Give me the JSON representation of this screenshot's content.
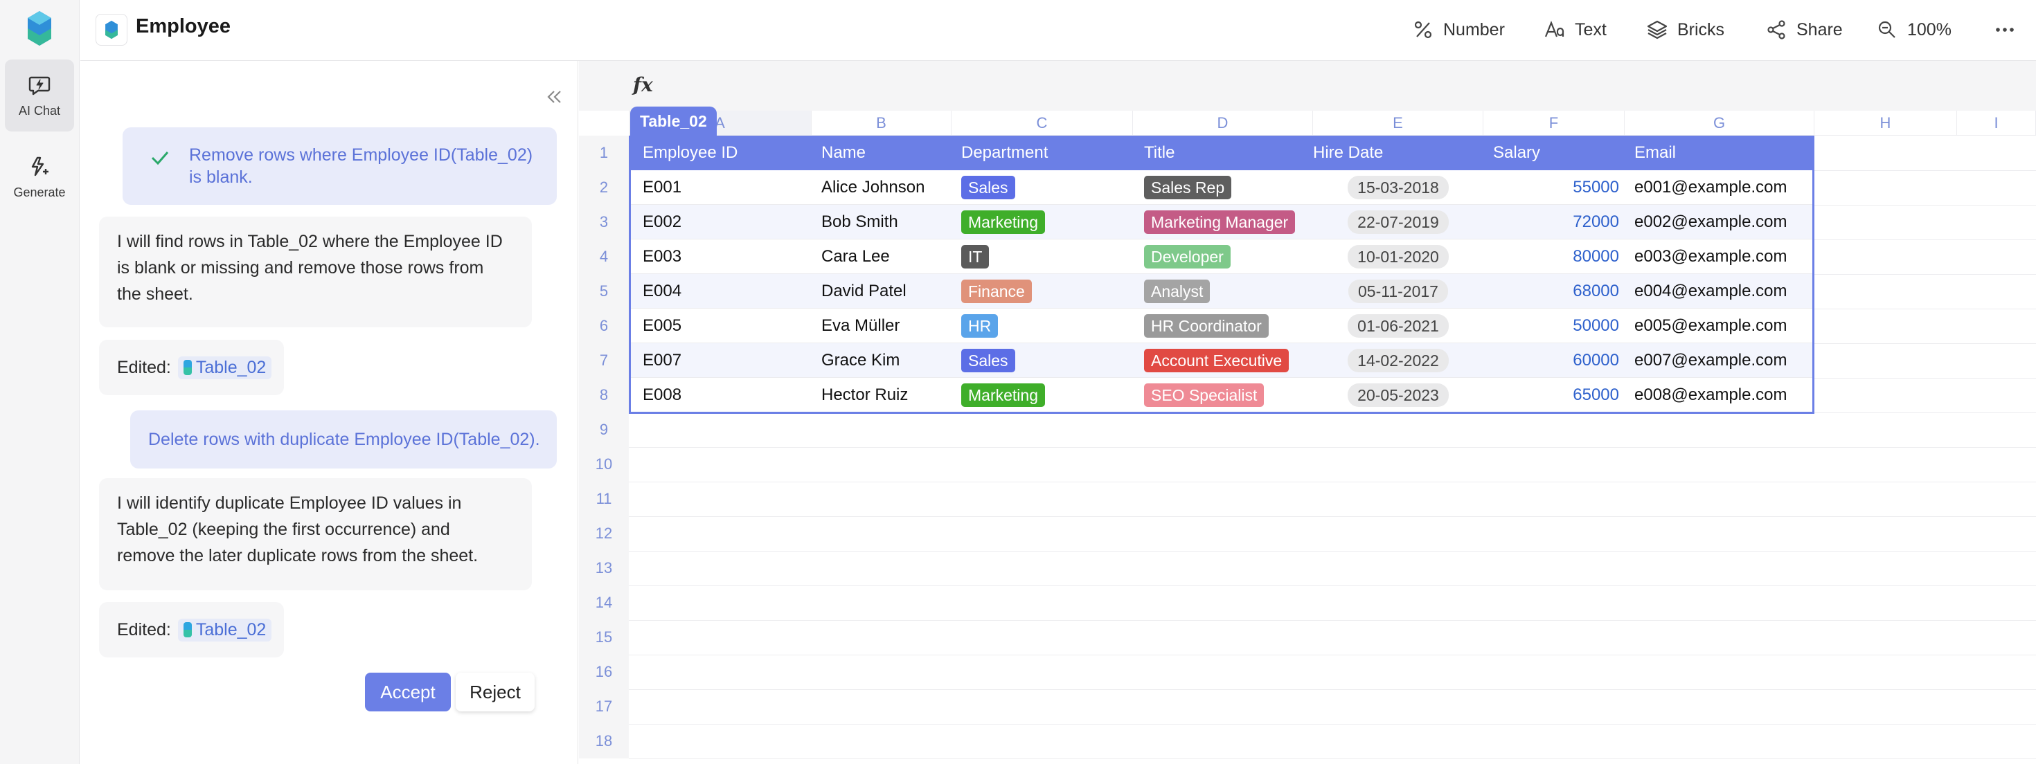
{
  "app": {
    "title": "Employee"
  },
  "rail": {
    "items": [
      {
        "label": "AI Chat"
      },
      {
        "label": "Generate"
      }
    ]
  },
  "toolbar": {
    "number": "Number",
    "text": "Text",
    "bricks": "Bricks",
    "share": "Share",
    "zoom": "100%"
  },
  "chat": {
    "messages": [
      {
        "role": "user",
        "text": "Remove rows where Employee ID(Table_02) is blank.",
        "checked": true
      },
      {
        "role": "ai",
        "text": "I will find rows in Table_02 where the Employee ID is blank or missing and remove those rows from the sheet."
      },
      {
        "role": "edited",
        "label": "Edited:",
        "ref": "Table_02"
      },
      {
        "role": "user",
        "text": "Delete rows with duplicate Employee ID(Table_02)."
      },
      {
        "role": "ai",
        "text": "I will identify duplicate Employee ID values in Table_02 (keeping the first occurrence) and remove the later duplicate rows from the sheet."
      },
      {
        "role": "edited",
        "label": "Edited:",
        "ref": "Table_02"
      }
    ],
    "accept_label": "Accept",
    "reject_label": "Reject"
  },
  "sheet": {
    "fx_label": "fx",
    "table_name": "Table_02",
    "columns": [
      "A",
      "B",
      "C",
      "D",
      "E",
      "F",
      "G",
      "H",
      "I"
    ],
    "row_numbers": [
      "1",
      "2",
      "3",
      "4",
      "5",
      "6",
      "7",
      "8",
      "9",
      "10",
      "11",
      "12",
      "13",
      "14",
      "15",
      "16",
      "17",
      "18"
    ],
    "headers": [
      "Employee ID",
      "Name",
      "Department",
      "Title",
      "Hire Date",
      "Salary",
      "Email"
    ],
    "rows": [
      {
        "id": "E001",
        "name": "Alice Johnson",
        "dept": "Sales",
        "dept_color": "#5c6ee6",
        "title": "Sales Rep",
        "title_color": "#5e5e5e",
        "hire": "15-03-2018",
        "salary": "55000",
        "email": "e001@example.com"
      },
      {
        "id": "E002",
        "name": "Bob Smith",
        "dept": "Marketing",
        "dept_color": "#3fae2a",
        "title": "Marketing Manager",
        "title_color": "#c45b86",
        "hire": "22-07-2019",
        "salary": "72000",
        "email": "e002@example.com"
      },
      {
        "id": "E003",
        "name": "Cara Lee",
        "dept": "IT",
        "dept_color": "#5a5a5a",
        "title": "Developer",
        "title_color": "#7ec98a",
        "hire": "10-01-2020",
        "salary": "80000",
        "email": "e003@example.com"
      },
      {
        "id": "E004",
        "name": "David Patel",
        "dept": "Finance",
        "dept_color": "#e0927a",
        "title": "Analyst",
        "title_color": "#a4a4a4",
        "hire": "05-11-2017",
        "salary": "68000",
        "email": "e004@example.com"
      },
      {
        "id": "E005",
        "name": "Eva Müller",
        "dept": "HR",
        "dept_color": "#5aa4ea",
        "title": "HR Coordinator",
        "title_color": "#9a9a9a",
        "hire": "01-06-2021",
        "salary": "50000",
        "email": "e005@example.com"
      },
      {
        "id": "E007",
        "name": "Grace Kim",
        "dept": "Sales",
        "dept_color": "#5c6ee6",
        "title": "Account Executive",
        "title_color": "#e14a43",
        "hire": "14-02-2022",
        "salary": "60000",
        "email": "e007@example.com"
      },
      {
        "id": "E008",
        "name": "Hector Ruiz",
        "dept": "Marketing",
        "dept_color": "#3fae2a",
        "title": "SEO Specialist",
        "title_color": "#ef8a95",
        "hire": "20-05-2023",
        "salary": "65000",
        "email": "e008@example.com"
      }
    ]
  },
  "colors": {
    "accent": "#6b7fe6",
    "header_bg": "#6b7fe6",
    "stripe": "#f3f5fd",
    "salary": "#2d60cc"
  }
}
